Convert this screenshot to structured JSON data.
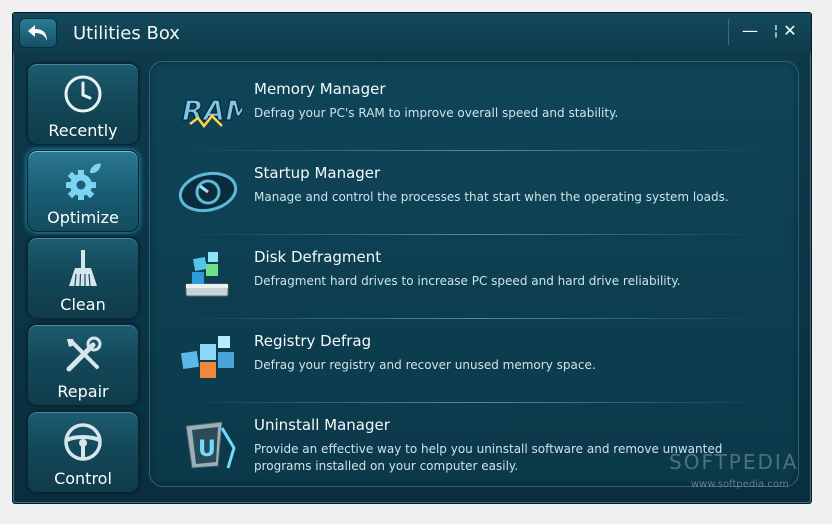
{
  "window": {
    "title": "Utilities Box"
  },
  "controls": {
    "minimize": "—",
    "maximize": "¦",
    "close": "✕"
  },
  "sidebar": {
    "items": [
      {
        "label": "Recently",
        "icon": "clock-icon"
      },
      {
        "label": "Optimize",
        "icon": "gear-leaf-icon",
        "active": true
      },
      {
        "label": "Clean",
        "icon": "broom-icon"
      },
      {
        "label": "Repair",
        "icon": "tools-icon"
      },
      {
        "label": "Control",
        "icon": "steering-wheel-icon"
      }
    ]
  },
  "utilities": [
    {
      "title": "Memory Manager",
      "desc": "Defrag your PC's RAM to improve overall speed and stability.",
      "icon": "ram-icon"
    },
    {
      "title": "Startup Manager",
      "desc": "Manage and control the processes that start when the operating system loads.",
      "icon": "startup-gauge-icon"
    },
    {
      "title": "Disk Defragment",
      "desc": "Defragment hard drives to increase PC speed and hard drive reliability.",
      "icon": "disk-defrag-icon"
    },
    {
      "title": "Registry Defrag",
      "desc": "Defrag your registry and recover unused memory space.",
      "icon": "registry-cubes-icon"
    },
    {
      "title": "Uninstall Manager",
      "desc": "Provide an effective way to help you uninstall software and remove unwanted programs installed on your computer easily.",
      "icon": "uninstall-bin-icon"
    }
  ],
  "watermark": {
    "brand": "SOFTPEDIA",
    "url": "www.softpedia.com"
  },
  "colors": {
    "accent": "#2aa0c8",
    "background": "#0b3445",
    "text": "#ffffff"
  }
}
